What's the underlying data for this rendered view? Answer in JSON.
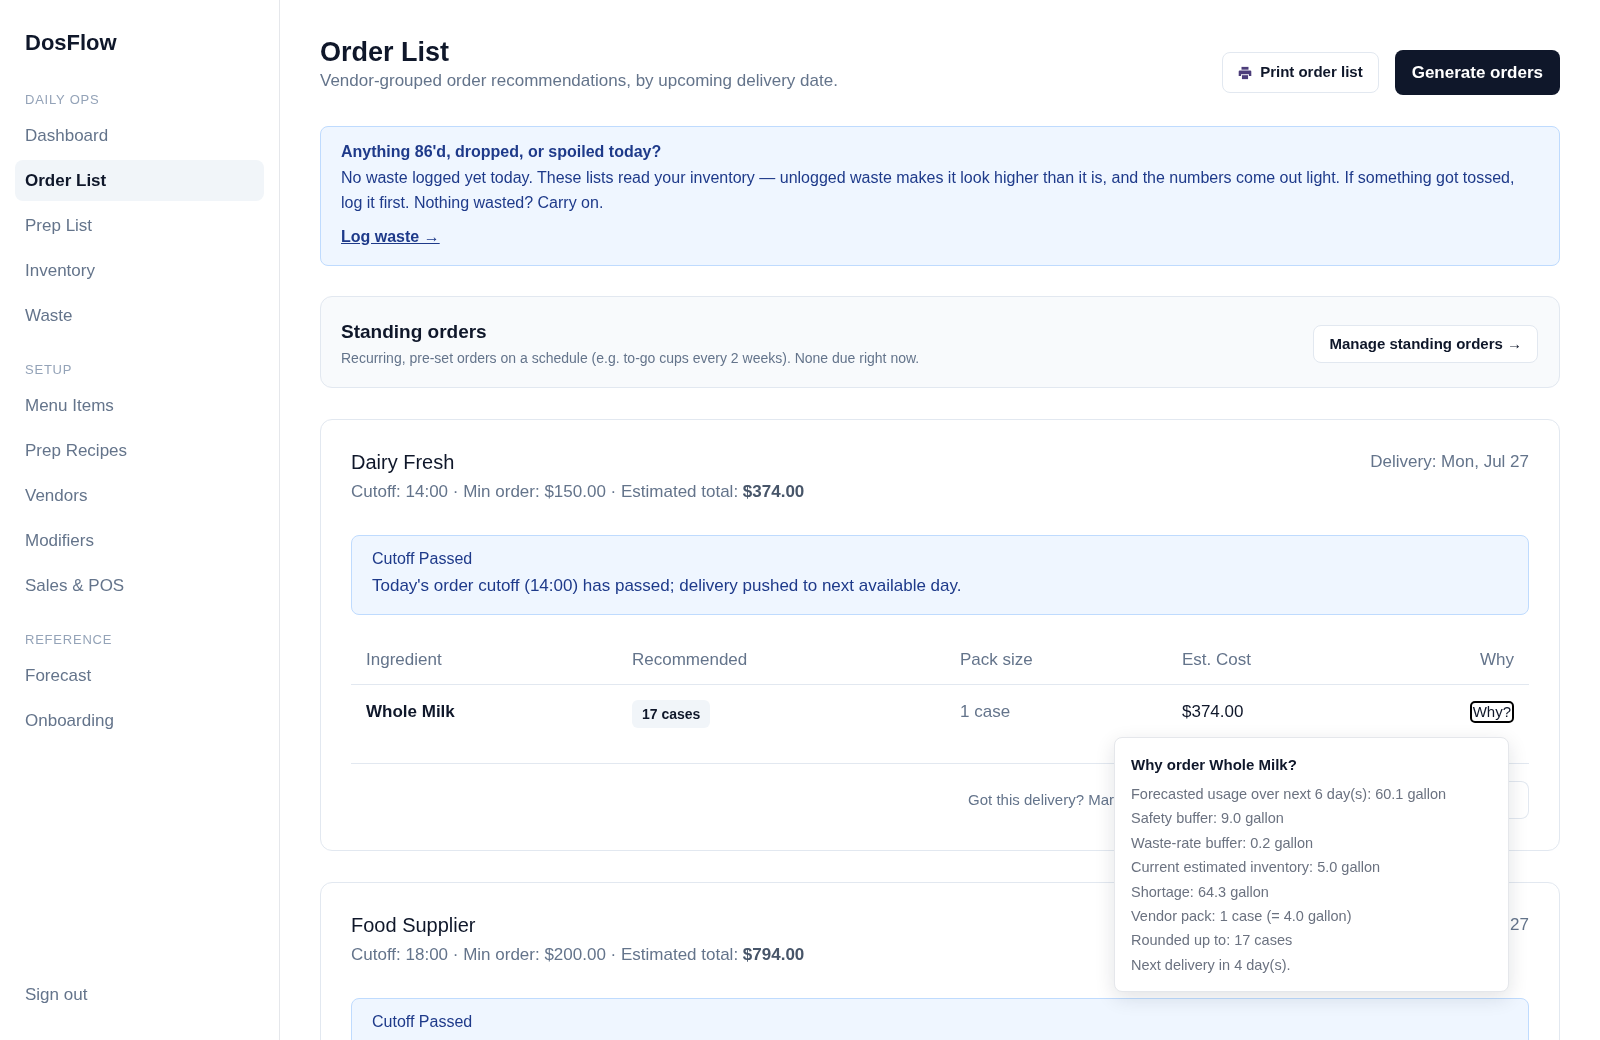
{
  "sidebar": {
    "brand": "DosFlow",
    "sections": [
      {
        "label": "DAILY OPS",
        "items": [
          {
            "label": "Dashboard",
            "selected": false
          },
          {
            "label": "Order List",
            "selected": true
          },
          {
            "label": "Prep List",
            "selected": false
          },
          {
            "label": "Inventory",
            "selected": false
          },
          {
            "label": "Waste",
            "selected": false
          }
        ]
      },
      {
        "label": "SETUP",
        "items": [
          {
            "label": "Menu Items",
            "selected": false
          },
          {
            "label": "Prep Recipes",
            "selected": false
          },
          {
            "label": "Vendors",
            "selected": false
          },
          {
            "label": "Modifiers",
            "selected": false
          },
          {
            "label": "Sales & POS",
            "selected": false
          }
        ]
      },
      {
        "label": "REFERENCE",
        "items": [
          {
            "label": "Forecast",
            "selected": false
          },
          {
            "label": "Onboarding",
            "selected": false
          }
        ]
      }
    ],
    "sign_out": "Sign out"
  },
  "header": {
    "title": "Order List",
    "subtitle": "Vendor-grouped order recommendations, by upcoming delivery date.",
    "print_button": "Print order list",
    "generate_button": "Generate orders"
  },
  "waste_banner": {
    "title": "Anything 86'd, dropped, or spoiled today?",
    "text": "No waste logged yet today. These lists read your inventory — unlogged waste makes it look higher than it is, and the numbers come out light. If something got tossed, log it first. Nothing wasted? Carry on.",
    "link": "Log waste →"
  },
  "standing_orders": {
    "title": "Standing orders",
    "description": "Recurring, pre-set orders on a schedule (e.g. to-go cups every 2 weeks). None due right now.",
    "button": "Manage standing orders →"
  },
  "vendors": [
    {
      "name": "Dairy Fresh",
      "details": "Cutoff: 14:00 · Min order: $150.00 · Estimated total: **$374.00**",
      "delivery": "Delivery: Mon, Jul 27",
      "alert": {
        "title": "Cutoff Passed",
        "text": "Today's order cutoff (14:00) has passed; delivery pushed to next available day."
      },
      "table": {
        "columns": [
          "Ingredient",
          "Recommended",
          "Pack size",
          "Est. Cost",
          "Why"
        ],
        "rows": [
          {
            "ingredient": "Whole Milk",
            "recommended": "17 cases",
            "pack_size": "1 case",
            "est_cost": "$374.00",
            "why": {
              "label": "Why?",
              "focused": true
            }
          }
        ]
      },
      "footer_text": "Got this delivery? Mar"
    },
    {
      "name": "Food Supplier",
      "details": "Cutoff: 18:00 · Min order: $200.00 · Estimated total: **$794.00**",
      "delivery": "27",
      "alert": {
        "title": "Cutoff Passed"
      }
    }
  ],
  "why_popover": {
    "title": "Why order Whole Milk?",
    "lines": [
      "Forecasted usage over next 6 day(s): 60.1 gallon",
      "Safety buffer: 9.0 gallon",
      "Waste-rate buffer: 0.2 gallon",
      "Current estimated inventory: 5.0 gallon",
      "Shortage: 64.3 gallon",
      "Vendor pack: 1 case (= 4.0 gallon)",
      "Rounded up to: 17 cases",
      "Next delivery in 4 day(s)."
    ]
  }
}
